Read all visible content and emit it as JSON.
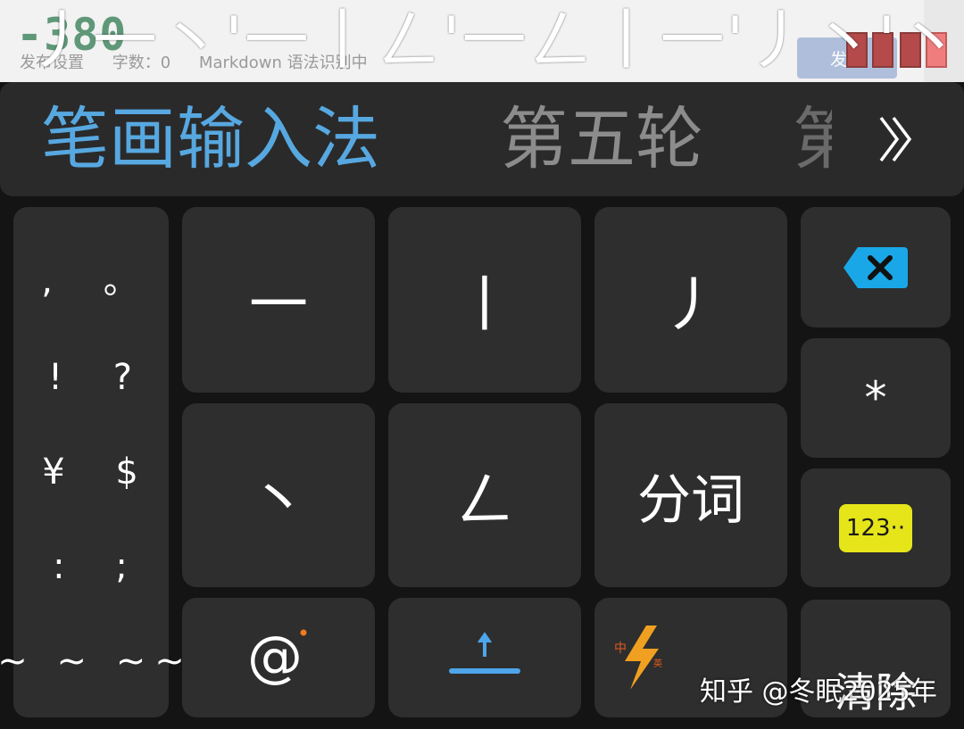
{
  "editor": {
    "count": "-380",
    "settings_label": "发布设置",
    "word_count": "字数：0",
    "markdown_status": "Markdown 语法识别中",
    "publish_label": "发布"
  },
  "composition": {
    "text": "丿一丶'一丨ㄥ'一ㄥ丨一'丿丶'丶"
  },
  "candidates": {
    "primary": "笔画输入法",
    "secondary": "第五轮",
    "partial": "第"
  },
  "keyboard": {
    "symbols": [
      ",  。",
      "!  ?",
      "¥  $",
      ":  ;",
      "~ ~ ~~"
    ],
    "strokes": {
      "heng": "一",
      "shu": "丨",
      "pie": "丿",
      "dian": "丶",
      "zhe": "ㄥ"
    },
    "segment_label": "分词",
    "star_label": "*",
    "numbers_label": "123··",
    "clear_label": "清除"
  },
  "watermark": "知乎 @冬眠2025年",
  "colors": {
    "background": "#141414",
    "key": "#2e2e2e",
    "accent_blue": "#57a8e0",
    "delete_blue": "#1aa7e8",
    "numbers_yellow": "#e5e51a"
  },
  "icons": [
    "backspace-icon",
    "at-icon",
    "upload-icon",
    "language-switch-icon",
    "double-chevron-right-icon"
  ]
}
